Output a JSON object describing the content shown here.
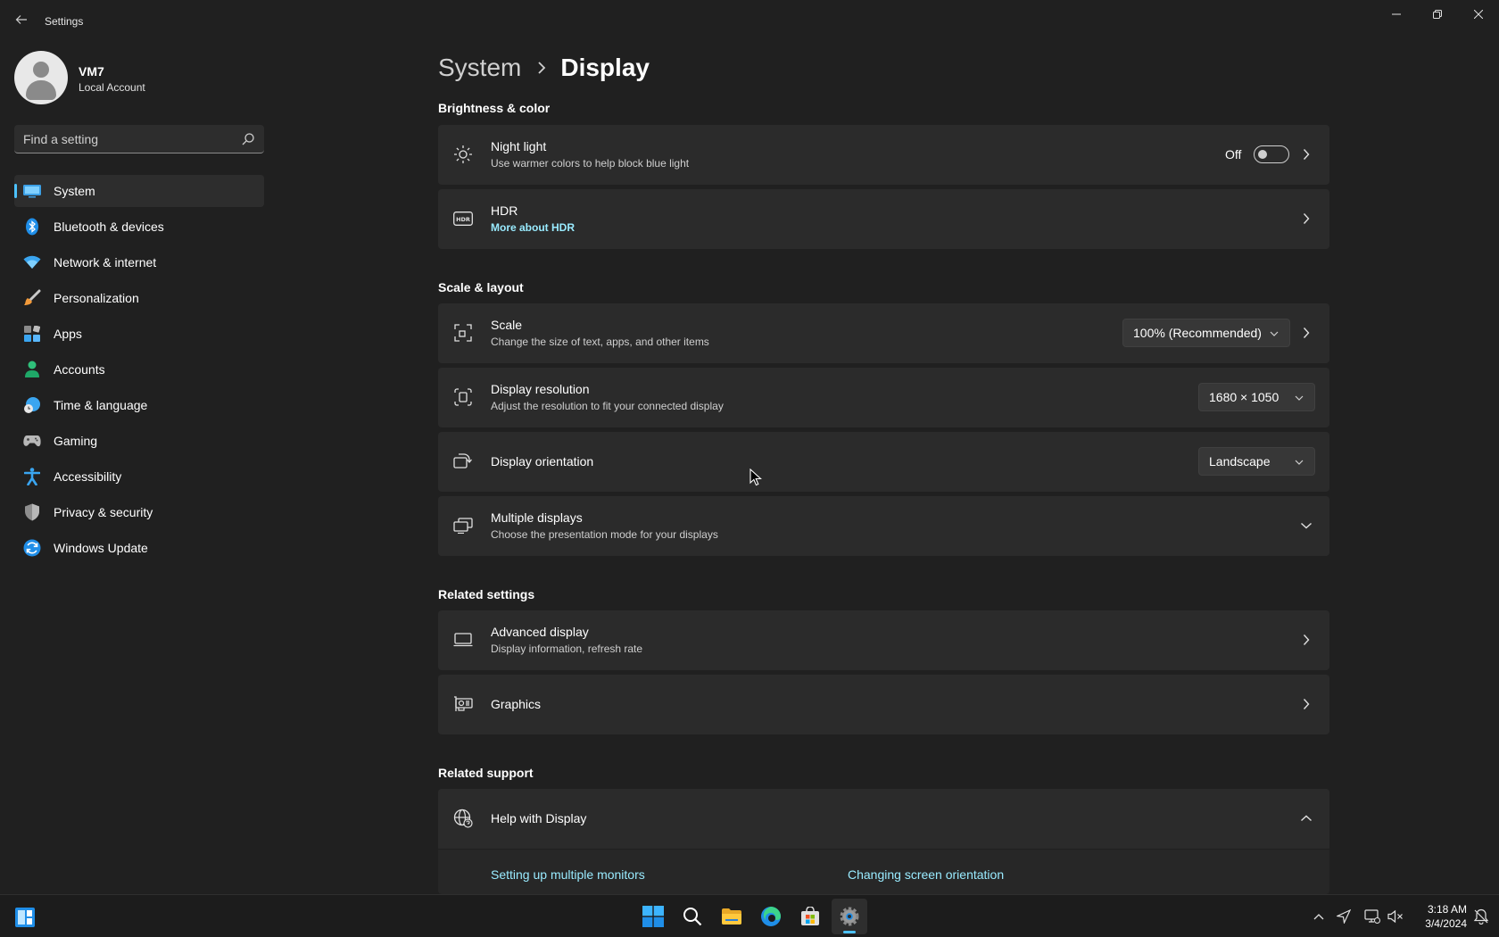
{
  "window": {
    "title": "Settings"
  },
  "profile": {
    "name": "VM7",
    "account_type": "Local Account"
  },
  "search": {
    "placeholder": "Find a setting"
  },
  "sidebar": {
    "items": [
      {
        "label": "System",
        "icon": "system-icon",
        "active": true
      },
      {
        "label": "Bluetooth & devices",
        "icon": "bluetooth-icon"
      },
      {
        "label": "Network & internet",
        "icon": "wifi-icon"
      },
      {
        "label": "Personalization",
        "icon": "brush-icon"
      },
      {
        "label": "Apps",
        "icon": "apps-icon"
      },
      {
        "label": "Accounts",
        "icon": "accounts-icon"
      },
      {
        "label": "Time & language",
        "icon": "clock-globe-icon"
      },
      {
        "label": "Gaming",
        "icon": "gamepad-icon"
      },
      {
        "label": "Accessibility",
        "icon": "accessibility-icon"
      },
      {
        "label": "Privacy & security",
        "icon": "shield-icon"
      },
      {
        "label": "Windows Update",
        "icon": "update-icon"
      }
    ]
  },
  "breadcrumb": {
    "parent": "System",
    "current": "Display"
  },
  "sections": {
    "brightness": "Brightness & color",
    "scale_layout": "Scale & layout",
    "related_settings": "Related settings",
    "related_support": "Related support"
  },
  "night_light": {
    "title": "Night light",
    "subtitle": "Use warmer colors to help block blue light",
    "state_label": "Off",
    "on": false
  },
  "hdr": {
    "title": "HDR",
    "link": "More about HDR"
  },
  "scale": {
    "title": "Scale",
    "subtitle": "Change the size of text, apps, and other items",
    "value": "100% (Recommended)"
  },
  "resolution": {
    "title": "Display resolution",
    "subtitle": "Adjust the resolution to fit your connected display",
    "value": "1680 × 1050"
  },
  "orientation": {
    "title": "Display orientation",
    "value": "Landscape"
  },
  "multiple_displays": {
    "title": "Multiple displays",
    "subtitle": "Choose the presentation mode for your displays"
  },
  "advanced_display": {
    "title": "Advanced display",
    "subtitle": "Display information, refresh rate"
  },
  "graphics": {
    "title": "Graphics"
  },
  "help": {
    "title": "Help with Display",
    "links": [
      "Setting up multiple monitors",
      "Changing screen orientation"
    ]
  },
  "taskbar": {
    "time": "3:18 AM",
    "date": "3/4/2024"
  },
  "colors": {
    "accent": "#4cc2ff",
    "link": "#99ebff",
    "background": "#202020",
    "card": "#2b2b2b"
  }
}
